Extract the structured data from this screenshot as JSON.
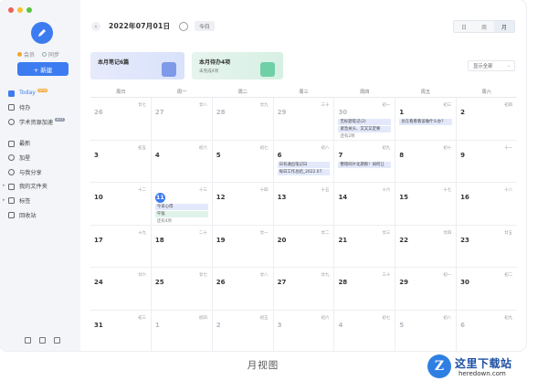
{
  "sidebar": {
    "vip": "会员",
    "sync": "同步",
    "new_button": "+ 新建",
    "items": [
      {
        "label": "Today",
        "badge": "NEW"
      },
      {
        "label": "待办"
      },
      {
        "label": "学术资源加速",
        "badge": "HOT"
      },
      {
        "label": "最新"
      },
      {
        "label": "加星"
      },
      {
        "label": "与我分享"
      },
      {
        "label": "我的文件夹"
      },
      {
        "label": "标签"
      },
      {
        "label": "回收站"
      }
    ]
  },
  "toolbar": {
    "prev": "‹",
    "date": "2022年07月01日",
    "today": "今日",
    "views": [
      "日",
      "周",
      "月"
    ]
  },
  "cards": {
    "notes_title": "本月笔记6篇",
    "todo_title": "本月待办4项",
    "todo_sub": "未完成4项"
  },
  "filter": {
    "label": "显示全部",
    "chev": "⌄"
  },
  "weekdays": [
    "周日",
    "周一",
    "周二",
    "周三",
    "周四",
    "周五",
    "周六"
  ],
  "weeks": [
    [
      {
        "n": "26",
        "l": "廿七",
        "dim": true
      },
      {
        "n": "27",
        "l": "廿八",
        "dim": true
      },
      {
        "n": "28",
        "l": "廿九",
        "dim": true
      },
      {
        "n": "29",
        "l": "三十",
        "dim": true
      },
      {
        "n": "30",
        "l": "初一",
        "dim": true,
        "events": [
          {
            "t": "无标题笔记(2)",
            "c": "blue"
          },
          {
            "t": "紧急关头、又又又定要",
            "c": "blue"
          },
          {
            "t": "还有2项",
            "c": "more"
          }
        ]
      },
      {
        "n": "1",
        "l": "初三",
        "events": [
          {
            "t": "总在看看看该做什么办?",
            "c": "blue"
          }
        ]
      },
      {
        "n": "2",
        "l": "初四"
      }
    ],
    [
      {
        "n": "3",
        "l": "初五"
      },
      {
        "n": "4",
        "l": "初六"
      },
      {
        "n": "5",
        "l": "初七"
      },
      {
        "n": "6",
        "l": "初八",
        "events": [
          {
            "t": "日有通出笔记日",
            "c": "blue"
          },
          {
            "t": "每日工作总结_2022.07.",
            "c": "blue"
          }
        ]
      },
      {
        "n": "7",
        "l": "初九",
        "events": [
          {
            "t": "整理碎片化期限！如何让",
            "c": "blue"
          }
        ]
      },
      {
        "n": "8",
        "l": "初十"
      },
      {
        "n": "9",
        "l": "十一"
      }
    ],
    [
      {
        "n": "10",
        "l": "十二"
      },
      {
        "n": "11",
        "l": "十三",
        "today": true,
        "events": [
          {
            "t": "今日心得",
            "c": "blue"
          },
          {
            "t": "午饭",
            "c": "green"
          },
          {
            "t": "还有4项",
            "c": "more"
          }
        ]
      },
      {
        "n": "12",
        "l": "十四"
      },
      {
        "n": "13",
        "l": "十五"
      },
      {
        "n": "14",
        "l": "十六"
      },
      {
        "n": "15",
        "l": "十七"
      },
      {
        "n": "16",
        "l": "十八"
      }
    ],
    [
      {
        "n": "17",
        "l": "十九"
      },
      {
        "n": "18",
        "l": "二十"
      },
      {
        "n": "19",
        "l": "廿一"
      },
      {
        "n": "20",
        "l": "廿二"
      },
      {
        "n": "21",
        "l": "廿三"
      },
      {
        "n": "22",
        "l": "廿四"
      },
      {
        "n": "23",
        "l": "廿五"
      }
    ],
    [
      {
        "n": "24",
        "l": "廿六"
      },
      {
        "n": "25",
        "l": "廿七"
      },
      {
        "n": "26",
        "l": "廿八"
      },
      {
        "n": "27",
        "l": "廿九"
      },
      {
        "n": "28",
        "l": "三十"
      },
      {
        "n": "29",
        "l": "初一"
      },
      {
        "n": "30",
        "l": "初二"
      }
    ],
    [
      {
        "n": "31",
        "l": "初三"
      },
      {
        "n": "1",
        "l": "初四",
        "dim": true
      },
      {
        "n": "2",
        "l": "初五",
        "dim": true
      },
      {
        "n": "3",
        "l": "初六",
        "dim": true
      },
      {
        "n": "4",
        "l": "初七",
        "dim": true
      },
      {
        "n": "5",
        "l": "初八",
        "dim": true
      },
      {
        "n": "6",
        "l": "初九",
        "dim": true
      }
    ]
  ],
  "caption": "月视图",
  "watermark": {
    "logo": "Z",
    "cn": "这里下载站",
    "en": "heredown.com"
  }
}
